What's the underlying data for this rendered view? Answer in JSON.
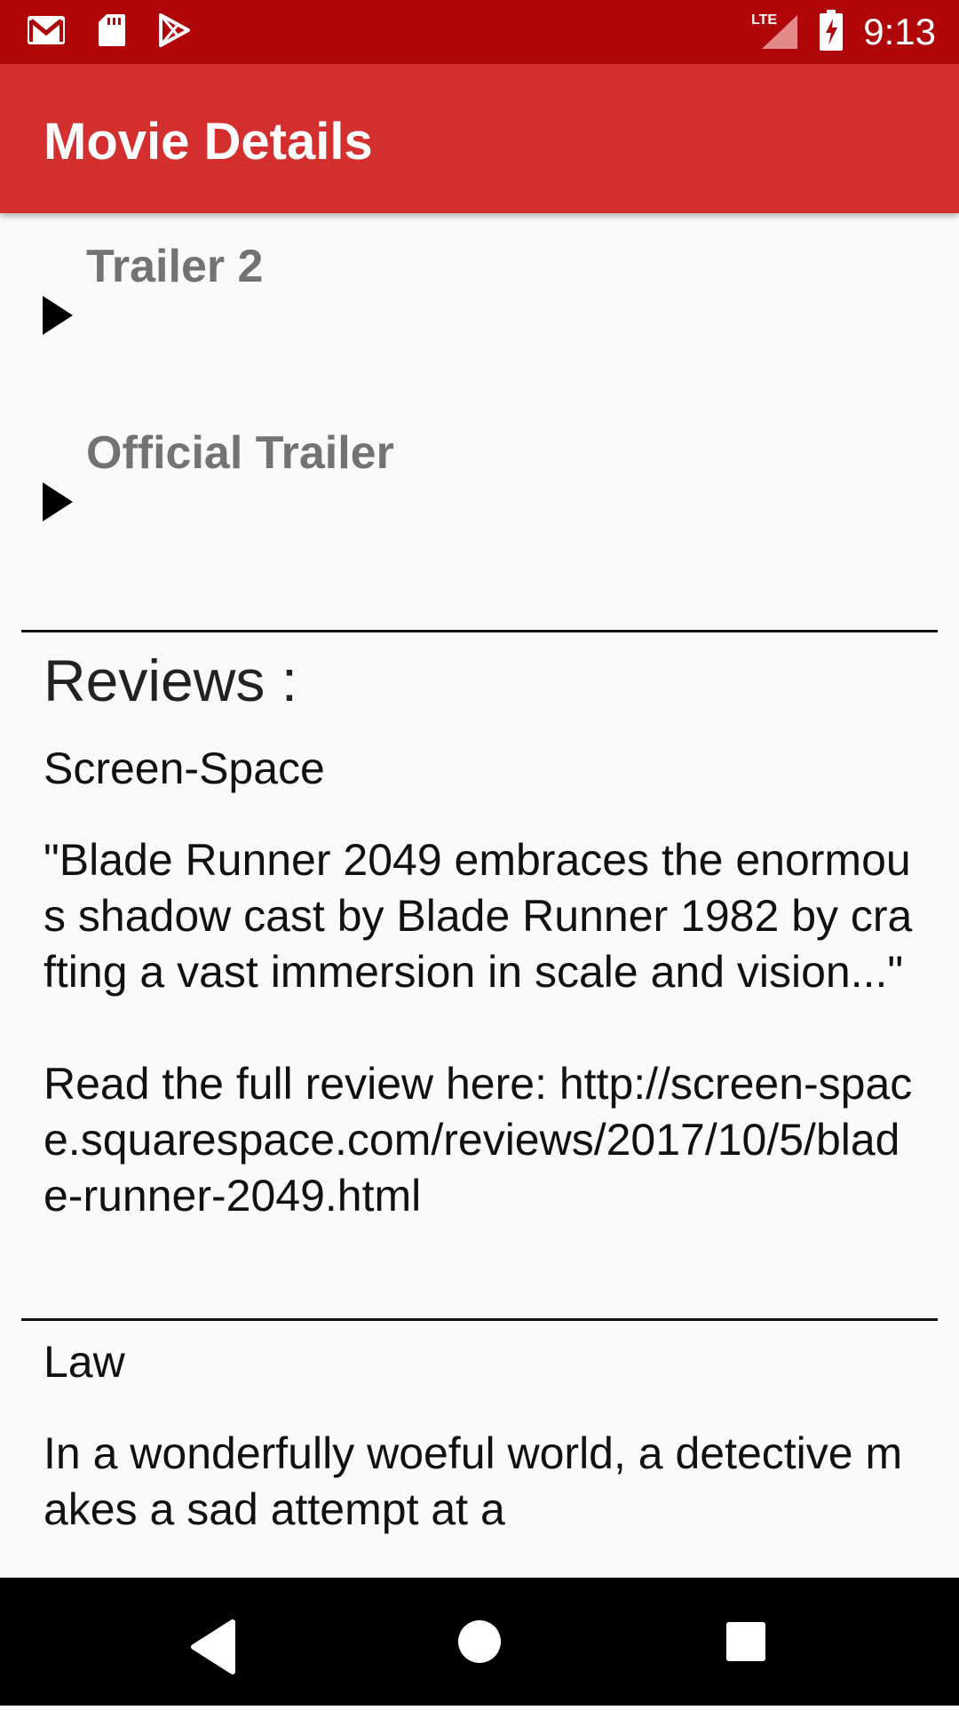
{
  "status_bar": {
    "time": "9:13",
    "network": "LTE",
    "icons": [
      "gmail-icon",
      "sd-card-icon",
      "play-store-icon",
      "lte-signal-icon",
      "battery-charging-icon"
    ]
  },
  "app_bar": {
    "title": "Movie Details"
  },
  "trailers": [
    {
      "label": "Trailer 2",
      "icon": "play-icon"
    },
    {
      "label": "Official Trailer",
      "icon": "play-icon"
    }
  ],
  "reviews": {
    "heading": "Reviews :",
    "items": [
      {
        "author": "Screen-Space",
        "text": "\"Blade Runner 2049 embraces the enormous shadow cast by Blade Runner 1982 by crafting a vast immersion in scale and vision...\"\n\nRead the full review here: http://screen-space.squarespace.com/reviews/2017/10/5/blade-runner-2049.html"
      },
      {
        "author": "Law",
        "text": "In a wonderfully woeful world, a detective makes a sad attempt at a"
      }
    ]
  },
  "nav_bar": {
    "buttons": [
      "back-icon",
      "home-icon",
      "recents-icon"
    ]
  },
  "colors": {
    "status_bar": "#af0609",
    "app_bar": "#d32f2f",
    "trailer_label": "#737373",
    "background": "#fafafa"
  }
}
